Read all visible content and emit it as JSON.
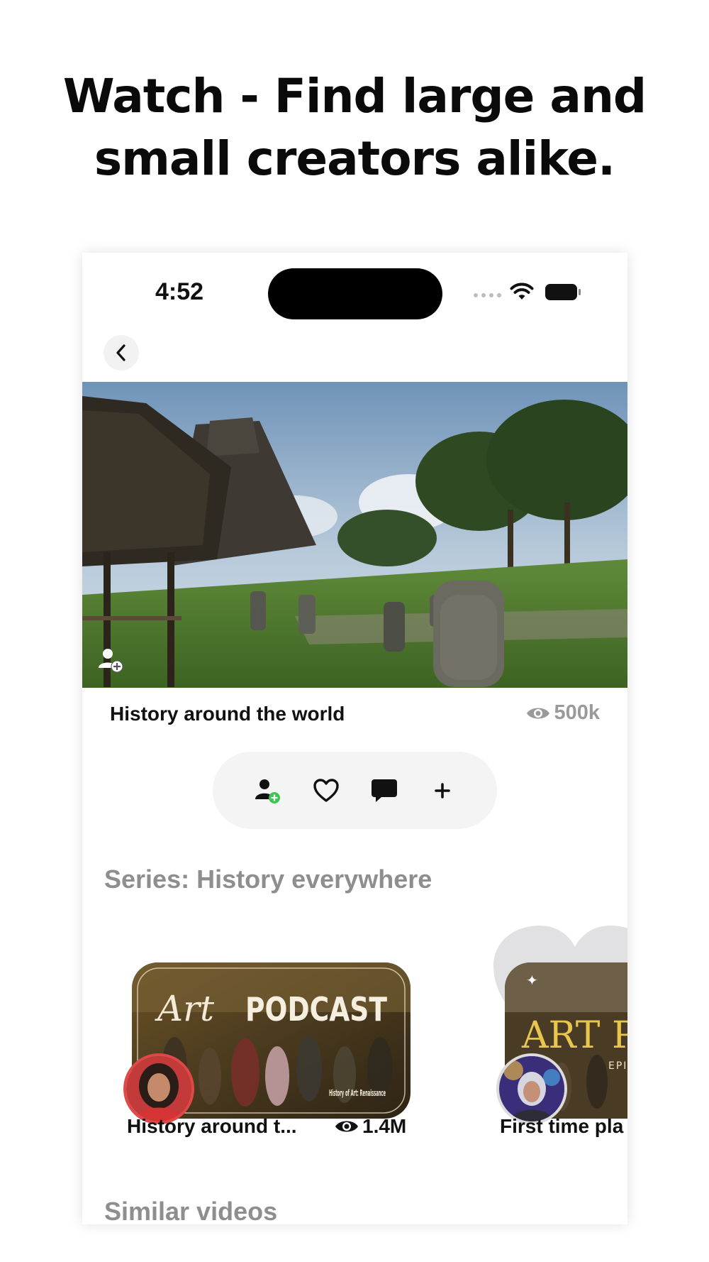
{
  "headline": {
    "line1": "Watch - Find large and",
    "line2": "small creators alike."
  },
  "status_bar": {
    "time": "4:52"
  },
  "video": {
    "title": "History around the world",
    "views": "500k"
  },
  "series": {
    "heading": "Series: History everywhere",
    "items": [
      {
        "title": "History around t...",
        "views": "1.4M",
        "thumb_title_script": "Art",
        "thumb_title_block": "PODCAST",
        "thumb_subtitle": "History of Art: Renaissance"
      },
      {
        "title": "First time pla",
        "thumb_title_block": "ART PO",
        "thumb_subtitle": "EPIS"
      }
    ]
  },
  "similar": {
    "heading": "Similar videos"
  },
  "colors": {
    "accent_green": "#3cc552",
    "muted_text": "#8e8e8e",
    "action_bar_bg": "#f4f4f4"
  }
}
